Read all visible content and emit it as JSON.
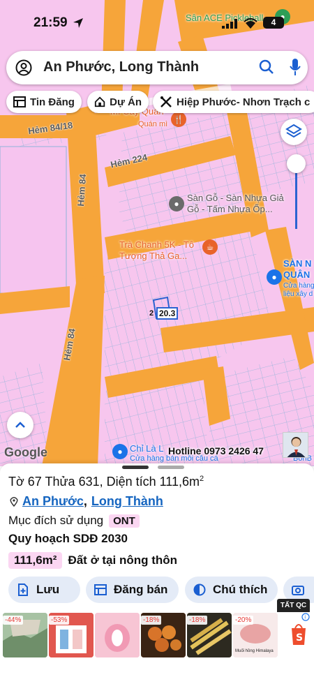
{
  "status_bar": {
    "time": "21:59",
    "battery": "4"
  },
  "search": {
    "text": "An Phước, Long Thành"
  },
  "chips": [
    {
      "label": "Tin Đăng",
      "icon": "listing-icon"
    },
    {
      "label": "Dự Án",
      "icon": "project-house-icon"
    },
    {
      "label": "Hiệp Phước- Nhơn Trạch c",
      "icon": "tools-icon"
    }
  ],
  "map": {
    "roads": [
      "Hẻm 84/18",
      "Hẻm 224",
      "Hẻm 84",
      "Hẻm 84"
    ],
    "pois": [
      {
        "name": "Sân ACE Pickleball",
        "color": "#2e9e56"
      },
      {
        "name": "Mì Cay Quân",
        "sub": "Quán mì",
        "color": "#e8632a"
      },
      {
        "name": "Sàn Gỗ - Sàn Nhựa Giả Gỗ - Tấm Nhựa Ốp...",
        "color": "#6b6b6b"
      },
      {
        "name": "Trà Chanh 5K - Tô Tượng Thả Ga...",
        "color": "#e8632a"
      },
      {
        "name": "SÀN N QUÂN",
        "sub": "Cửa hàng liệu xây d",
        "color": "#1b73e8"
      },
      {
        "name": "Chỉ Là L",
        "sub": "Cửa hàng bán mồi câu cá",
        "color": "#1b73e8"
      },
      {
        "name": "BonB",
        "color": "#1b73e8"
      }
    ],
    "plot_label": "20.3",
    "plot_label_prefix": "2",
    "watermark": "Google",
    "hotline": "Hotline 0973 2426 47"
  },
  "sheet": {
    "title": "Tờ 67 Thửa 631, Diện tích 111,6m",
    "title_sup": "2",
    "location_a": "An Phước",
    "location_b": "Long Thành",
    "purpose_label": "Mục đích sử dụng",
    "purpose_code": "ONT",
    "plan_label": "Quy hoạch SDĐ 2030",
    "area_value": "111,6m²",
    "area_desc": "Đất ở tại nông thôn",
    "actions": [
      {
        "label": "Lưu",
        "icon": "save-doc-icon"
      },
      {
        "label": "Đăng bán",
        "icon": "post-sale-icon"
      },
      {
        "label": "Chú thích",
        "icon": "legend-contrast-icon"
      },
      {
        "label": "",
        "icon": "camera-add-icon"
      }
    ]
  },
  "ads": {
    "label": "TẤT QC",
    "items": [
      {
        "discount": "-44%",
        "color": "#9bb89a"
      },
      {
        "discount": "-53%",
        "color": "#d9534f"
      },
      {
        "discount": "",
        "color": "#f4b6c8"
      },
      {
        "discount": "-18%",
        "color": "#c26a2e"
      },
      {
        "discount": "-18%",
        "color": "#c9a54a"
      },
      {
        "discount": "-20%",
        "color": "#f2dede"
      }
    ],
    "last_item_caption": "Muối hồng Himalaya"
  }
}
